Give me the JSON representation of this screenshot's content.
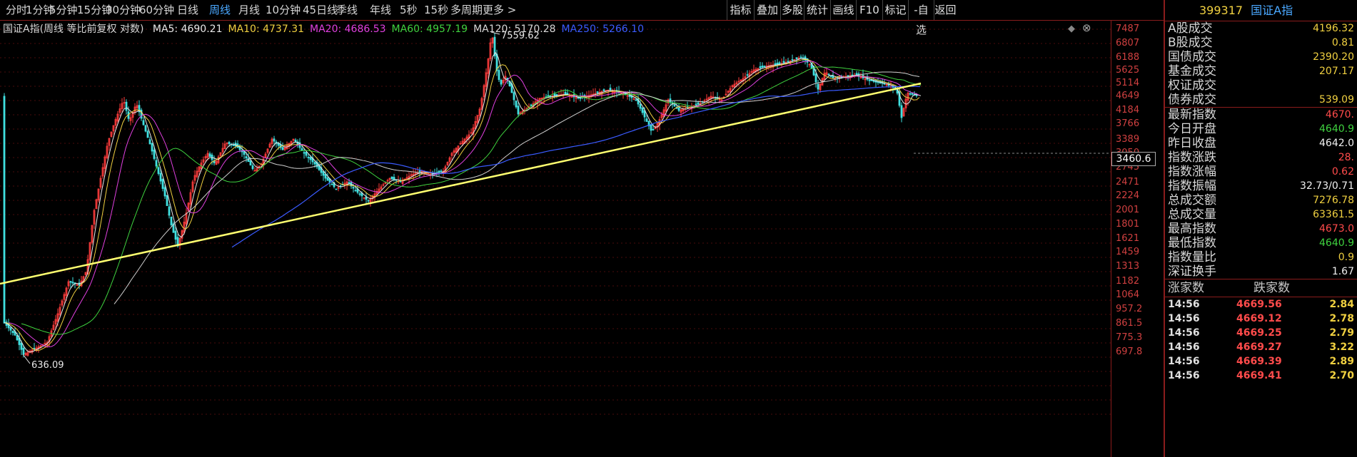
{
  "toolbar": {
    "periods": [
      "分时",
      "1分钟",
      "5分钟",
      "15分钟",
      "30分钟",
      "60分钟",
      "日线",
      "周线",
      "月线",
      "10分钟",
      "45日线",
      "季线",
      "年线",
      "5秒",
      "15秒",
      "多周期",
      "更多 >"
    ],
    "active": "周线",
    "tools": [
      "指标",
      "叠加",
      "多股",
      "统计",
      "画线",
      "F10",
      "标记",
      "-自选",
      "返回"
    ]
  },
  "legend": {
    "title": "国证A指(周线 等比前复权 对数)",
    "ma": [
      {
        "label": "MA5: 4690.21",
        "color": "#e8e8e8"
      },
      {
        "label": "MA10: 4737.31",
        "color": "#f0d040"
      },
      {
        "label": "MA20: 4686.53",
        "color": "#e040e0"
      },
      {
        "label": "MA60: 4957.19",
        "color": "#3fd23f"
      },
      {
        "label": "MA120: 5170.28",
        "color": "#d8d8d8"
      },
      {
        "label": "MA250: 5266.10",
        "color": "#3a5bff"
      }
    ]
  },
  "axis": {
    "ticks": [
      "7487",
      "6807",
      "6188",
      "5625",
      "5114",
      "4649",
      "4184",
      "3766",
      "3389",
      "3050",
      "2745",
      "2471",
      "2224",
      "2001",
      "1801",
      "1621",
      "1459",
      "1313",
      "1182",
      "1064",
      "957.2",
      "861.5",
      "775.3",
      "697.8"
    ],
    "cursor_price": "3460.6"
  },
  "annotations": {
    "high": "7559.62",
    "low": "636.09"
  },
  "panel": {
    "code": "399317",
    "name": "国证A指",
    "rows": [
      {
        "label": "A股成交",
        "value": "4196.32",
        "cls": "yellow"
      },
      {
        "label": "B股成交",
        "value": "0.81",
        "cls": "yellow"
      },
      {
        "label": "国债成交",
        "value": "2390.20",
        "cls": "yellow"
      },
      {
        "label": "基金成交",
        "value": "207.17",
        "cls": "yellow"
      },
      {
        "label": "权证成交",
        "value": "",
        "cls": "yellow"
      },
      {
        "label": "债券成交",
        "value": "539.09",
        "cls": "yellow"
      },
      {
        "label": "最新指数",
        "value": "4670.",
        "cls": "red"
      },
      {
        "label": "今日开盘",
        "value": "4640.9",
        "cls": "green"
      },
      {
        "label": "昨日收盘",
        "value": "4642.0",
        "cls": "white"
      },
      {
        "label": "指数涨跌",
        "value": "28.",
        "cls": "red"
      },
      {
        "label": "指数涨幅",
        "value": "0.62",
        "cls": "red"
      },
      {
        "label": "指数振幅",
        "value": "32.73/0.71",
        "cls": "white"
      },
      {
        "label": "总成交额",
        "value": "7276.78",
        "cls": "yellow"
      },
      {
        "label": "总成交量",
        "value": "63361.5",
        "cls": "yellow"
      },
      {
        "label": "最高指数",
        "value": "4673.0",
        "cls": "red"
      },
      {
        "label": "最低指数",
        "value": "4640.9",
        "cls": "green"
      },
      {
        "label": "指数量比",
        "value": "0.9",
        "cls": "yellow"
      },
      {
        "label": "深证换手",
        "value": "1.67",
        "cls": "white"
      }
    ],
    "breadth": {
      "up_label": "涨家数",
      "down_label": "跌家数"
    },
    "trades": [
      {
        "time": "14:56",
        "price": "4669.56",
        "vol": "2.84"
      },
      {
        "time": "14:56",
        "price": "4669.12",
        "vol": "2.78"
      },
      {
        "time": "14:56",
        "price": "4669.25",
        "vol": "2.79"
      },
      {
        "time": "14:56",
        "price": "4669.27",
        "vol": "3.22"
      },
      {
        "time": "14:56",
        "price": "4669.39",
        "vol": "2.89"
      },
      {
        "time": "14:56",
        "price": "4669.41",
        "vol": "2.70"
      }
    ]
  },
  "colors": {
    "up": "#ff3c3c",
    "down": "#40e0e0",
    "trend": "#ffff70",
    "grid": "#5a1010"
  }
}
